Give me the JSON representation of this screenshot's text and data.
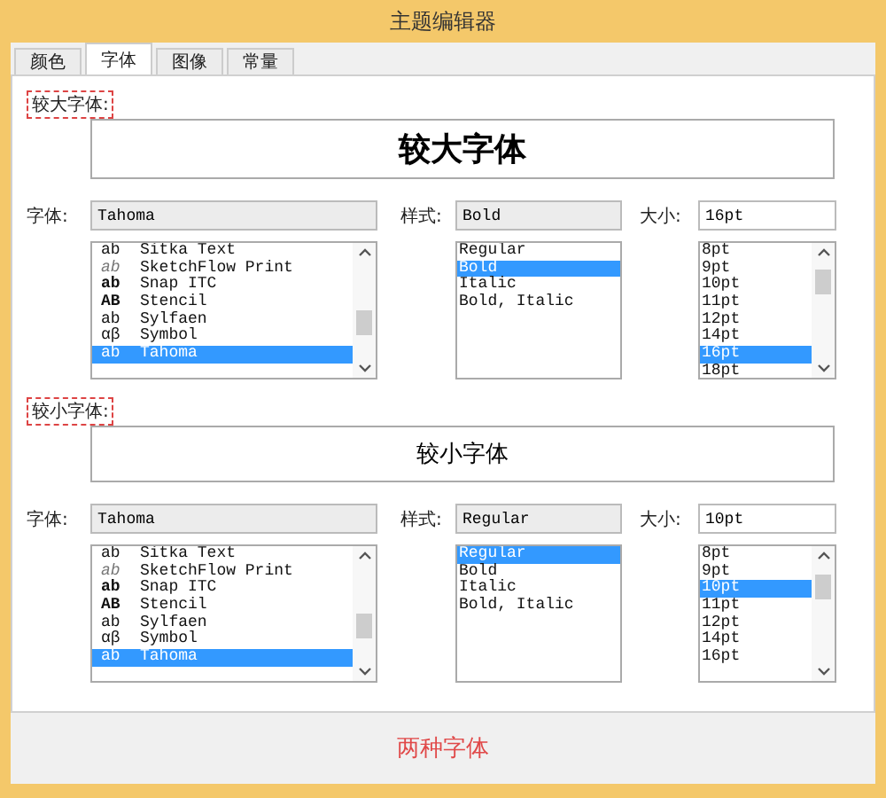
{
  "window": {
    "title": "主题编辑器"
  },
  "tabs": [
    {
      "label": "颜色",
      "selected": false
    },
    {
      "label": "字体",
      "selected": true
    },
    {
      "label": "图像",
      "selected": false
    },
    {
      "label": "常量",
      "selected": false
    }
  ],
  "sections": [
    {
      "label": "较大字体:",
      "preview": "较大字体",
      "kind": "large",
      "fields": [
        {
          "label": "字体:",
          "value": "Tahoma",
          "editable": false
        },
        {
          "label": "样式:",
          "value": "Bold",
          "editable": false
        },
        {
          "label": "大小:",
          "value": "16pt",
          "editable": true
        }
      ],
      "font_list": [
        {
          "sample": "ab",
          "name": "Sitka Text",
          "selected": false
        },
        {
          "sample": "ab",
          "name": "SketchFlow Print",
          "selected": false
        },
        {
          "sample": "ab",
          "name": "Snap ITC",
          "selected": false
        },
        {
          "sample": "AB",
          "name": "Stencil",
          "selected": false
        },
        {
          "sample": "ab",
          "name": "Sylfaen",
          "selected": false
        },
        {
          "sample": "αβ",
          "name": "Symbol",
          "selected": false
        },
        {
          "sample": "ab",
          "name": "Tahoma",
          "selected": true
        }
      ],
      "style_list": [
        {
          "label": "Regular",
          "selected": false
        },
        {
          "label": "Bold",
          "selected": true
        },
        {
          "label": "Italic",
          "selected": false
        },
        {
          "label": "Bold, Italic",
          "selected": false
        }
      ],
      "size_list": [
        {
          "label": "8pt",
          "selected": false
        },
        {
          "label": "9pt",
          "selected": false
        },
        {
          "label": "10pt",
          "selected": false
        },
        {
          "label": "11pt",
          "selected": false
        },
        {
          "label": "12pt",
          "selected": false
        },
        {
          "label": "14pt",
          "selected": false
        },
        {
          "label": "16pt",
          "selected": true
        },
        {
          "label": "18pt",
          "selected": false
        }
      ]
    },
    {
      "label": "较小字体:",
      "preview": "较小字体",
      "kind": "small",
      "fields": [
        {
          "label": "字体:",
          "value": "Tahoma",
          "editable": false
        },
        {
          "label": "样式:",
          "value": "Regular",
          "editable": false
        },
        {
          "label": "大小:",
          "value": "10pt",
          "editable": true
        }
      ],
      "font_list": [
        {
          "sample": "ab",
          "name": "Sitka Text",
          "selected": false
        },
        {
          "sample": "ab",
          "name": "SketchFlow Print",
          "selected": false
        },
        {
          "sample": "ab",
          "name": "Snap ITC",
          "selected": false
        },
        {
          "sample": "AB",
          "name": "Stencil",
          "selected": false
        },
        {
          "sample": "ab",
          "name": "Sylfaen",
          "selected": false
        },
        {
          "sample": "αβ",
          "name": "Symbol",
          "selected": false
        },
        {
          "sample": "ab",
          "name": "Tahoma",
          "selected": true
        }
      ],
      "style_list": [
        {
          "label": "Regular",
          "selected": true
        },
        {
          "label": "Bold",
          "selected": false
        },
        {
          "label": "Italic",
          "selected": false
        },
        {
          "label": "Bold, Italic",
          "selected": false
        }
      ],
      "size_list": [
        {
          "label": "8pt",
          "selected": false
        },
        {
          "label": "9pt",
          "selected": false
        },
        {
          "label": "10pt",
          "selected": true
        },
        {
          "label": "11pt",
          "selected": false
        },
        {
          "label": "12pt",
          "selected": false
        },
        {
          "label": "14pt",
          "selected": false
        },
        {
          "label": "16pt",
          "selected": false
        }
      ]
    }
  ],
  "caption": "两种字体"
}
